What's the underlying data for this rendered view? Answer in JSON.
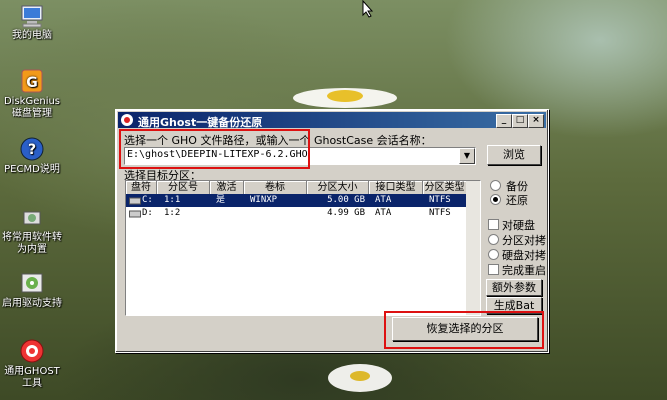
{
  "desktop": {
    "icons": [
      {
        "label": "我的电脑",
        "icon": "computer-icon"
      },
      {
        "label": "DiskGenius磁盘管理",
        "icon": "diskgenius-icon"
      },
      {
        "label": "PECMD说明",
        "icon": "help-icon"
      },
      {
        "label": "将常用软件转为内置",
        "icon": "software-icon"
      },
      {
        "label": "启用驱动支持",
        "icon": "driver-icon"
      },
      {
        "label": "通用GHOST工具",
        "icon": "ghost-icon"
      }
    ]
  },
  "window": {
    "title": "通用Ghost一键备份还原",
    "minimize": "_",
    "maximize": "□",
    "close": "×",
    "prompt_label": "选择一个 GHO 文件路径，或输入一个 GhostCase 会话名称：",
    "path_value": "E:\\ghost\\DEEPIN-LITEXP-6.2.GHO",
    "browse_label": "浏览",
    "partition_label": "选择目标分区：",
    "table": {
      "columns": [
        "盘符",
        "分区号",
        "激活",
        "卷标",
        "分区大小",
        "接口类型",
        "分区类型"
      ],
      "rows": [
        {
          "drive": "C:",
          "part": "1:1",
          "active": "是",
          "label": "WINXP",
          "size": "5.00 GB",
          "iface": "ATA",
          "fs": "NTFS",
          "selected": true
        },
        {
          "drive": "D:",
          "part": "1:2",
          "active": "",
          "label": "",
          "size": "4.99 GB",
          "iface": "ATA",
          "fs": "NTFS",
          "selected": false
        }
      ]
    },
    "options": {
      "backup": "备份",
      "restore": "还原",
      "restore_selected": true,
      "disk_to_disk": "对硬盘",
      "part_copy": "分区对拷",
      "disk_copy": "硬盘对拷",
      "reboot": "完成重启"
    },
    "extra_params": "额外参数",
    "gen_bat": "生成Bat",
    "restore_button": "恢复选择的分区"
  },
  "colors": {
    "titlebar": "#0a246a",
    "highlight_box": "#dd1111"
  }
}
